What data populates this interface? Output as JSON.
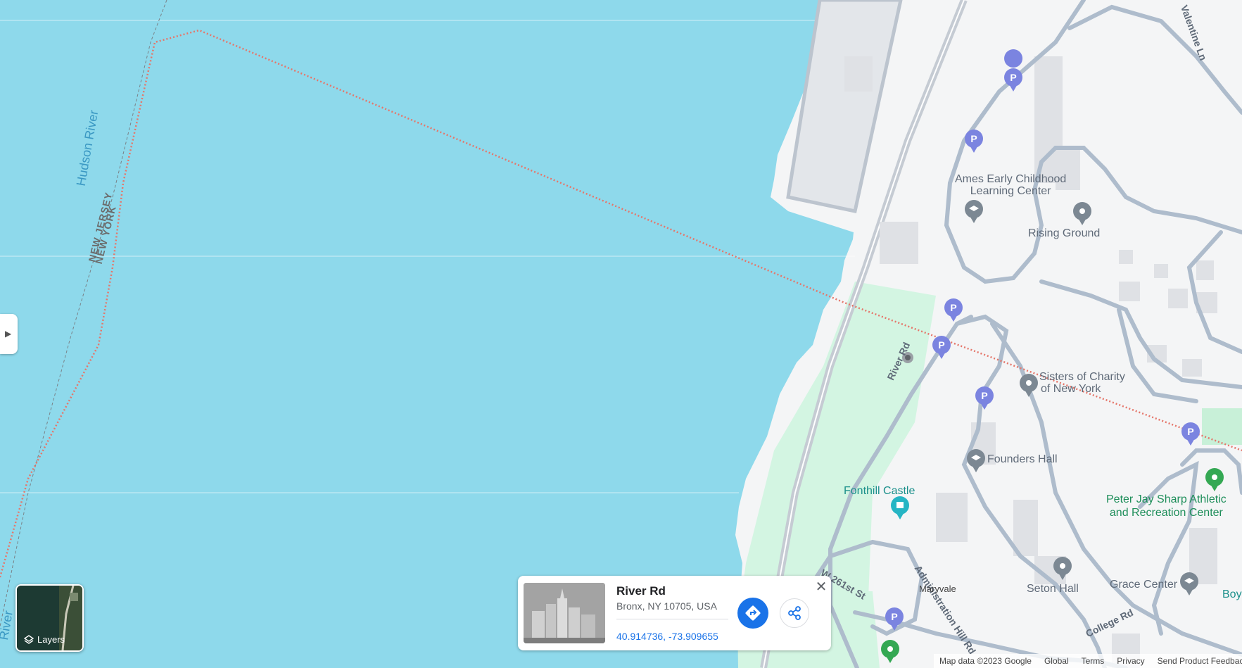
{
  "map": {
    "water_label_1": "Hudson River",
    "water_label_2": "River",
    "state_nj": "NEW JERSEY",
    "state_ny": "NEW YORK",
    "road_river_rd": "River Rd",
    "road_w261": "W 261st St",
    "road_admin": "Administration Hill Rd",
    "road_college": "College Rd",
    "road_valentine": "Valentine Ln",
    "poi_ames": "Ames Early Childhood Learning Center",
    "poi_ames_l1": "Ames Early Childhood",
    "poi_ames_l2": "Learning Center",
    "poi_rising": "Rising Ground",
    "poi_sisters_l1": "Sisters of Charity",
    "poi_sisters_l2": "of New York",
    "poi_founders": "Founders Hall",
    "poi_fonthill": "Fonthill Castle",
    "poi_peter_l1": "Peter Jay Sharp Athletic",
    "poi_peter_l2": "and Recreation Center",
    "poi_seton": "Seton Hall",
    "poi_grace": "Grace Center",
    "poi_maryvale": "Maryvale",
    "poi_boy": "Boy"
  },
  "icons": {
    "parking": "P",
    "parking_color": "#7b84e0",
    "pin_gray_color": "#7c8893",
    "pin_green_color": "#34a853",
    "pin_teal_color": "#26b5c4"
  },
  "colors": {
    "water": "#8ed9eb",
    "park": "#d3f5e2",
    "land": "#f4f5f6",
    "road": "#aebccc",
    "boundary": "#e5766a"
  },
  "layers": {
    "label": "Layers"
  },
  "place_card": {
    "title": "River Rd",
    "address": "Bronx, NY 10705, USA",
    "coordinates": "40.914736, -73.909655"
  },
  "footer": {
    "map_data": "Map data ©2023 Google",
    "global": "Global",
    "terms": "Terms",
    "privacy": "Privacy",
    "feedback": "Send Product Feedback"
  }
}
